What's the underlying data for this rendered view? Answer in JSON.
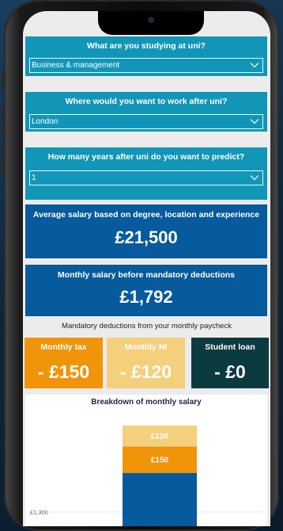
{
  "questions": [
    {
      "title": "What are you studying at uni?",
      "value": "Business & management"
    },
    {
      "title": "Where would you want to work after uni?",
      "value": "London"
    },
    {
      "title": "How many years after uni do you want to predict?",
      "value": "1"
    }
  ],
  "average_salary": {
    "title": "Average salary based on degree, location and experience",
    "value": "£21,500"
  },
  "monthly_salary": {
    "title": "Monthly salary before mandatory deductions",
    "value": "£1,792"
  },
  "deductions": {
    "title": "Mandatory deductions from your monthly paycheck",
    "items": [
      {
        "label": "Monthly tax",
        "value": "- £150",
        "color": "#f0940a"
      },
      {
        "label": "Monthly NI",
        "value": "- £120",
        "color": "#f4cf7c"
      },
      {
        "label": "Student loan",
        "value": "- £0",
        "color": "#0b3a3f"
      }
    ]
  },
  "colors": {
    "question_bg": "#1296b8",
    "salary_bg": "#075a9c"
  },
  "chart_data": {
    "type": "bar",
    "title": "Breakdown of monthly salary",
    "categories": [
      ""
    ],
    "series": [
      {
        "name": "",
        "values": [
          1522
        ],
        "color": "#075a9c"
      },
      {
        "name": "",
        "values": [
          150
        ],
        "label": "£150",
        "color": "#f0940a"
      },
      {
        "name": "",
        "values": [
          120
        ],
        "label": "£120",
        "color": "#f4cf7c"
      }
    ],
    "y_ticks": [
      {
        "value": 1300,
        "label": "£1,300"
      }
    ],
    "ylim": [
      1200,
      1850
    ],
    "stacked": true
  }
}
